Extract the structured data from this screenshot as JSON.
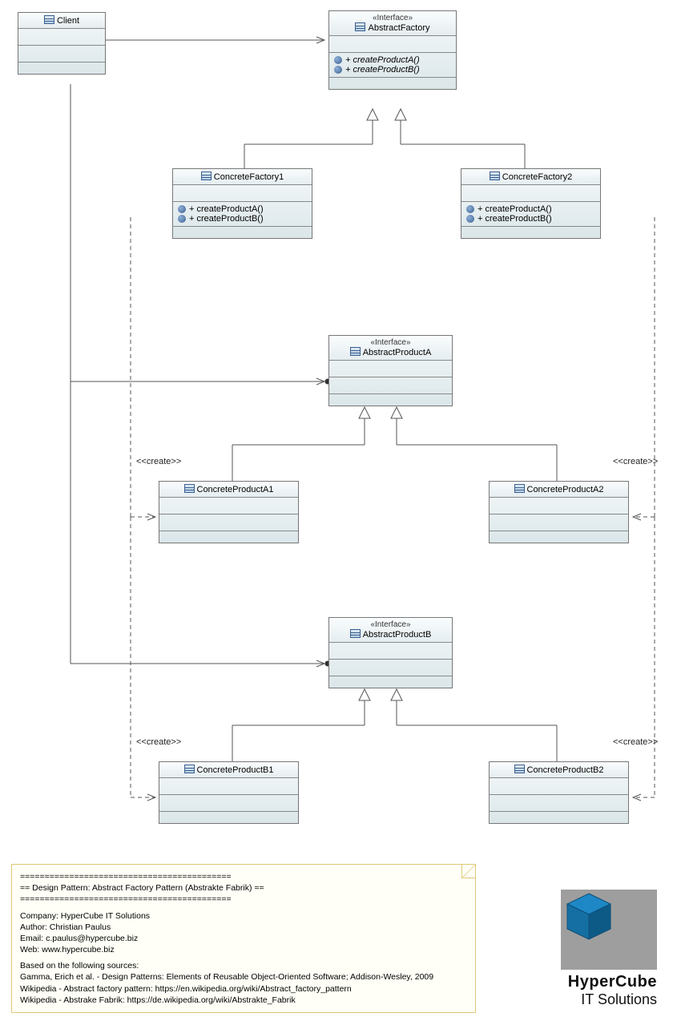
{
  "diagram_title": "Abstract Factory Pattern",
  "classes": {
    "client": {
      "name": "Client"
    },
    "abstractFactory": {
      "stereotype": "«Interface»",
      "name": "AbstractFactory",
      "ops": [
        "+ createProductA()",
        "+ createProductB()"
      ]
    },
    "concreteFactory1": {
      "name": "ConcreteFactory1",
      "ops": [
        "+ createProductA()",
        "+ createProductB()"
      ]
    },
    "concreteFactory2": {
      "name": "ConcreteFactory2",
      "ops": [
        "+ createProductA()",
        "+ createProductB()"
      ]
    },
    "abstractProductA": {
      "stereotype": "«Interface»",
      "name": "AbstractProductA"
    },
    "concreteProductA1": {
      "name": "ConcreteProductA1"
    },
    "concreteProductA2": {
      "name": "ConcreteProductA2"
    },
    "abstractProductB": {
      "stereotype": "«Interface»",
      "name": "AbstractProductB"
    },
    "concreteProductB1": {
      "name": "ConcreteProductB1"
    },
    "concreteProductB2": {
      "name": "ConcreteProductB2"
    }
  },
  "labels": {
    "create": "<<create>>"
  },
  "note": {
    "line1": "===========================================",
    "line2": "== Design Pattern: Abstract Factory Pattern (Abstrakte Fabrik) ==",
    "line3": "===========================================",
    "company": "Company: HyperCube IT Solutions",
    "author": "Author: Christian Paulus",
    "email": "Email: c.paulus@hypercube.biz",
    "web": "Web: www.hypercube.biz",
    "src0": "Based on the following sources:",
    "src1": "Gamma, Erich et al. - Design Patterns: Elements of Reusable Object-Oriented Software; Addison-Wesley, 2009",
    "src2": "Wikipedia - Abstract factory pattern: https://en.wikipedia.org/wiki/Abstract_factory_pattern",
    "src3": "Wikipedia - Abstrake Fabrik: https://de.wikipedia.org/wiki/Abstrakte_Fabrik"
  },
  "logo": {
    "line1": "HyperCube",
    "line2": "IT Solutions"
  }
}
